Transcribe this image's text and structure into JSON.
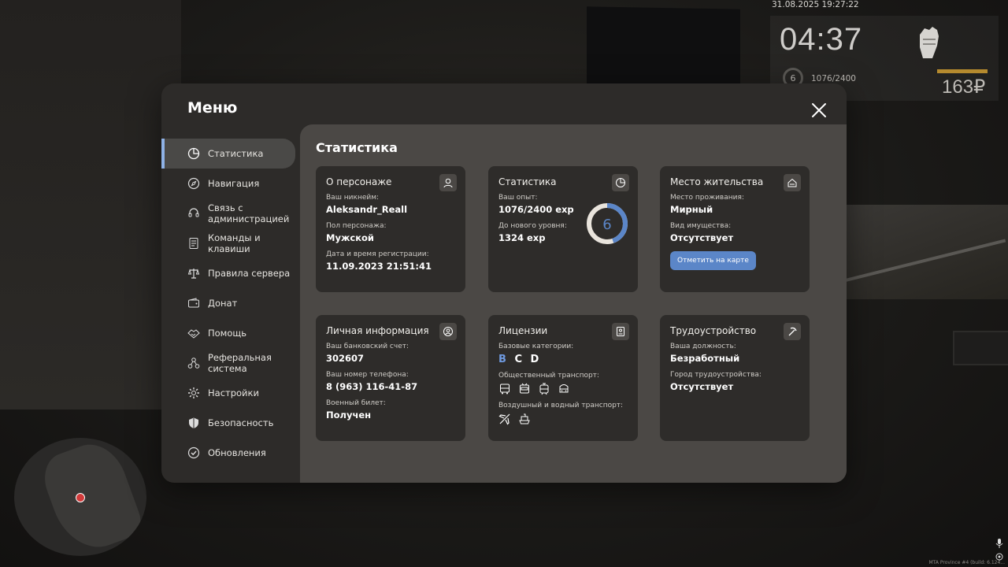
{
  "hud": {
    "datetime": "31.08.2025 19:27:22",
    "time": "04:37",
    "level": "6",
    "exp": "1076/2400",
    "money": "163₽"
  },
  "footer": {
    "build": "MTA Province #4 (build: 6.124..."
  },
  "menu": {
    "title": "Меню",
    "nav": [
      {
        "label": "Статистика",
        "icon": "pie-chart-icon",
        "active": true
      },
      {
        "label": "Навигация",
        "icon": "compass-icon"
      },
      {
        "label": "Связь с администрацией",
        "icon": "headset-icon"
      },
      {
        "label": "Команды и клавиши",
        "icon": "document-icon"
      },
      {
        "label": "Правила сервера",
        "icon": "scales-icon"
      },
      {
        "label": "Донат",
        "icon": "wallet-icon"
      },
      {
        "label": "Помощь",
        "icon": "handshake-icon"
      },
      {
        "label": "Реферальная система",
        "icon": "network-icon"
      },
      {
        "label": "Настройки",
        "icon": "gear-icon"
      },
      {
        "label": "Безопасность",
        "icon": "shield-icon"
      },
      {
        "label": "Обновления",
        "icon": "check-circle-icon"
      }
    ],
    "content_title": "Статистика",
    "cards": {
      "character": {
        "title": "О персонаже",
        "nick_label": "Ваш никнейм:",
        "nick": "Aleksandr_Reall",
        "gender_label": "Пол персонажа:",
        "gender": "Мужской",
        "reg_label": "Дата и время регистрации:",
        "reg": "11.09.2023 21:51:41"
      },
      "stats": {
        "title": "Статистика",
        "exp_label": "Ваш опыт:",
        "exp": "1076/2400 exp",
        "next_label": "До нового уровня:",
        "next": "1324 exp",
        "level": "6",
        "progress": 0.448
      },
      "residence": {
        "title": "Место жительства",
        "place_label": "Место проживания:",
        "place": "Мирный",
        "property_label": "Вид имущества:",
        "property": "Отсутствует",
        "button": "Отметить на карте"
      },
      "personal": {
        "title": "Личная информация",
        "bank_label": "Ваш банковский счет:",
        "bank": "302607",
        "phone_label": "Ваш номер телефона:",
        "phone": "8 (963) 116-41-87",
        "military_label": "Военный билет:",
        "military": "Получен"
      },
      "licenses": {
        "title": "Лицензии",
        "base_label": "Базовые категории:",
        "cat_b": "B",
        "cat_c": "C",
        "cat_d": "D",
        "public_label": "Общественный транспорт:",
        "air_label": "Воздушный и водный транспорт:"
      },
      "employment": {
        "title": "Трудоустройство",
        "position_label": "Ваша должность:",
        "position": "Безработный",
        "city_label": "Город трудоустройства:",
        "city": "Отсутствует"
      }
    }
  },
  "colors": {
    "accent": "#5b86c8",
    "active_bar": "#8fb2e6",
    "money_bar": "#b58a2e"
  }
}
